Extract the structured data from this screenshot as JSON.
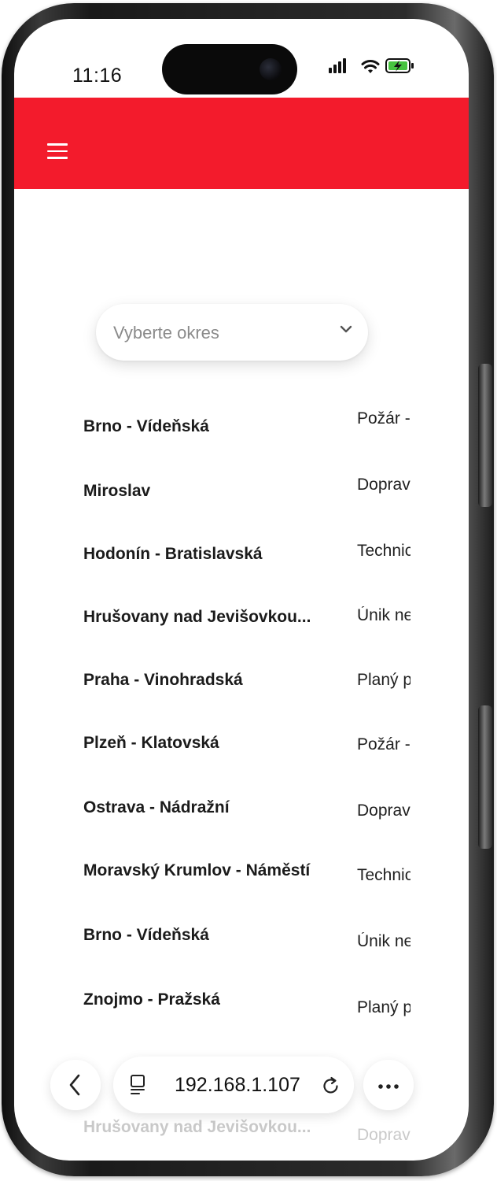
{
  "status_bar": {
    "time": "11:16"
  },
  "header": {
    "menu_icon": "hamburger-menu-icon",
    "color": "#f31b2c"
  },
  "district_select": {
    "placeholder": "Vyberte okres",
    "icon": "chevron-down-icon"
  },
  "incidents": [
    {
      "location": "Brno - Vídeňská",
      "type": "Požár -"
    },
    {
      "location": "Miroslav",
      "type": "Doprav"
    },
    {
      "location": "Hodonín - Bratislavská",
      "type": "Technic"
    },
    {
      "location": "Hrušovany nad Jevišovkou...",
      "type": "Únik ne"
    },
    {
      "location": "Praha - Vinohradská",
      "type": "Planý p"
    },
    {
      "location": "Plzeň - Klatovská",
      "type": "Požár -"
    },
    {
      "location": "Ostrava - Nádražní",
      "type": "Doprav"
    },
    {
      "location": "Moravský Krumlov - Náměstí",
      "type": "Technic"
    },
    {
      "location": "Brno - Vídeňská",
      "type": "Únik ne"
    },
    {
      "location": "Znojmo - Pražská",
      "type": "Planý p"
    },
    {
      "location": "Hrušovany nad Jevišovkou...",
      "type": "Doprav"
    }
  ],
  "browser_bar": {
    "url": "192.168.1.107",
    "back_icon": "back-chevron-icon",
    "tabs_icon": "tabs-icon",
    "reload_icon": "reload-icon",
    "more_icon": "more-icon"
  }
}
